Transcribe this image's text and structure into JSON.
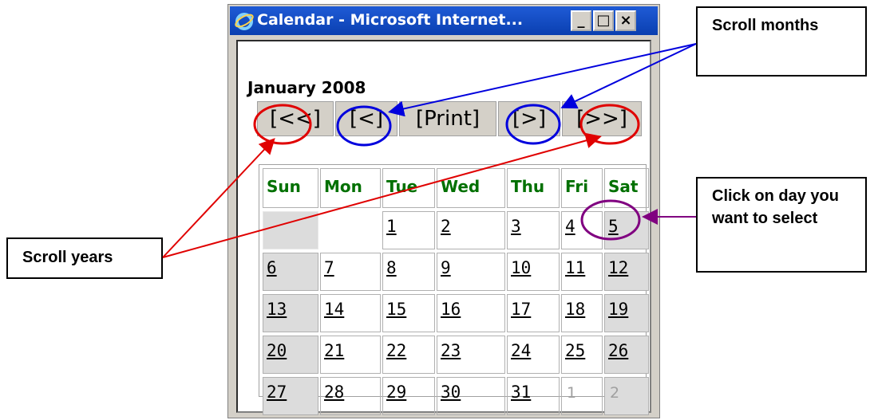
{
  "window": {
    "title": "Calendar - Microsoft Internet...",
    "buttons": {
      "minimize": "_",
      "maximize": "□",
      "close": "×"
    }
  },
  "calendar": {
    "month_title": "January 2008",
    "nav": {
      "prev_year": "[<<]",
      "prev_month": "[<]",
      "print": "[Print]",
      "next_month": "[>]",
      "next_year": "[>>]"
    },
    "weekdays": [
      "Sun",
      "Mon",
      "Tue",
      "Wed",
      "Thu",
      "Fri",
      "Sat"
    ],
    "weeks": [
      [
        "",
        "",
        "1",
        "2",
        "3",
        "4",
        "5"
      ],
      [
        "6",
        "7",
        "8",
        "9",
        "10",
        "11",
        "12"
      ],
      [
        "13",
        "14",
        "15",
        "16",
        "17",
        "18",
        "19"
      ],
      [
        "20",
        "21",
        "22",
        "23",
        "24",
        "25",
        "26"
      ],
      [
        "27",
        "28",
        "29",
        "30",
        "31",
        "1",
        "2"
      ]
    ]
  },
  "annotations": {
    "scroll_months": "Scroll months",
    "scroll_years": "Scroll years",
    "click_day": "Click on day you want to select",
    "colors": {
      "months": "#0000dd",
      "years": "#e00000",
      "day": "#800080"
    }
  }
}
